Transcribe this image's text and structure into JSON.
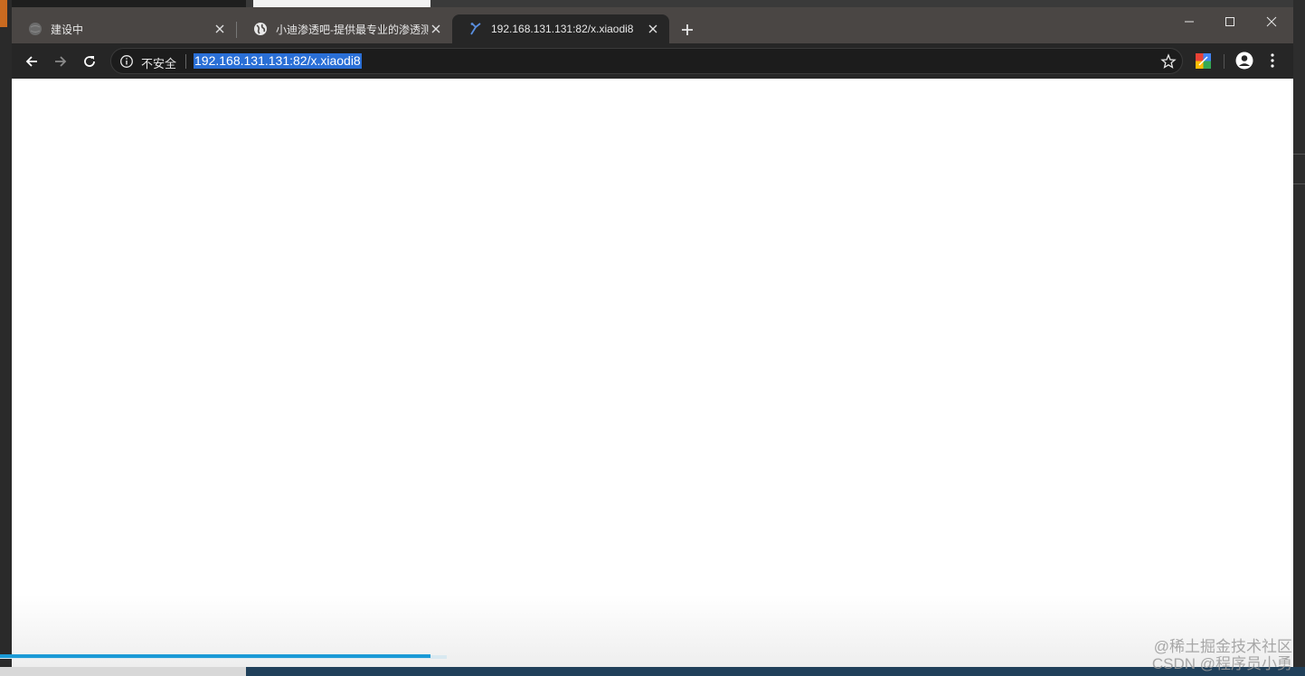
{
  "browser": {
    "tabs": [
      {
        "title": "建设中",
        "icon": "globe-gray-icon",
        "active": false
      },
      {
        "title": "小迪渗透吧-提供最专业的渗透测",
        "icon": "globe-icon",
        "active": false
      },
      {
        "title": "192.168.131.131:82/x.xiaodi8",
        "icon": "site-favicon",
        "active": true
      }
    ],
    "security_label": "不安全",
    "url": "192.168.131.131:82/x.xiaodi8"
  },
  "page_load_progress_percent": 33,
  "watermark": {
    "line1": "@稀土掘金技术社区",
    "line2": "CSDN @程序员小勇"
  },
  "colors": {
    "tabstrip": "#4a4644",
    "toolbar": "#262626",
    "url_highlight": "#2a6fd6",
    "progress": "#1a9ad6"
  }
}
